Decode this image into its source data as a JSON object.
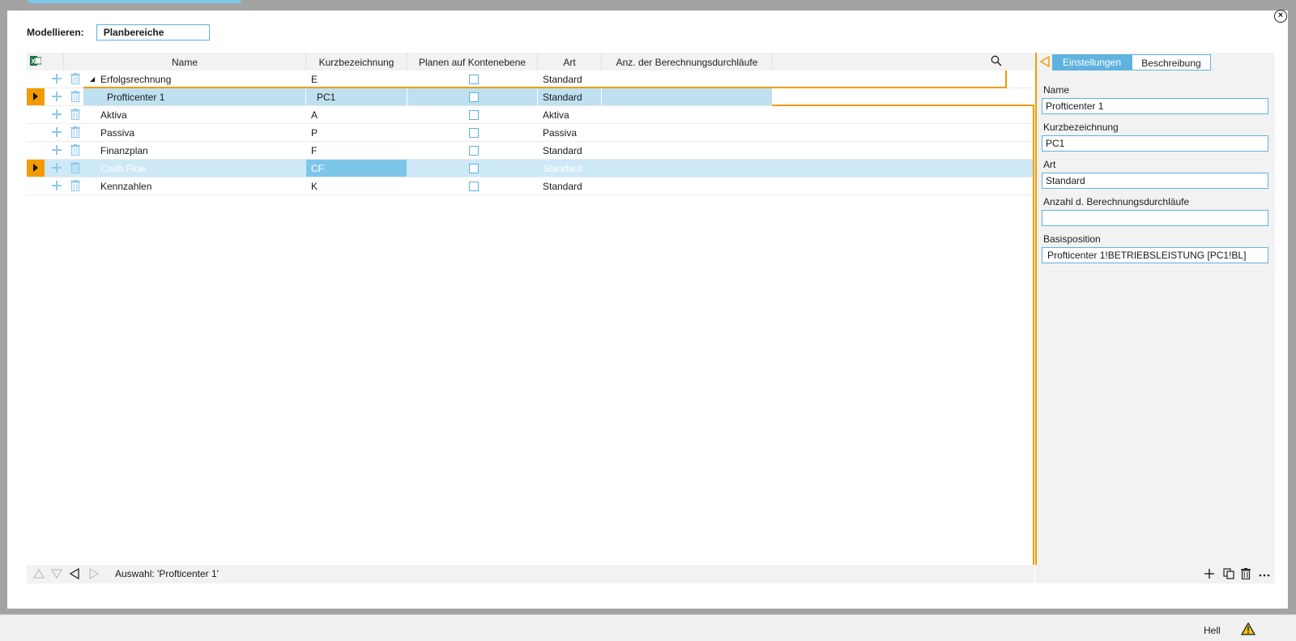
{
  "modeling": {
    "label": "Modellieren:",
    "value": "Planbereiche"
  },
  "grid": {
    "columns": [
      "Name",
      "Kurzbezeichnung",
      "Planen auf Kontenebene",
      "Art",
      "Anz. der Berechnungsdurchläufe"
    ],
    "rows": [
      {
        "name": "Erfolgsrechnung",
        "short": "E",
        "art": "Standard",
        "runs": "",
        "expanded": true,
        "state": "normal"
      },
      {
        "name": "Profticenter 1",
        "short": "PC1",
        "art": "Standard",
        "runs": "",
        "state": "selected"
      },
      {
        "name": "Aktiva",
        "short": "A",
        "art": "Aktiva",
        "runs": "",
        "state": "normal"
      },
      {
        "name": "Passiva",
        "short": "P",
        "art": "Passiva",
        "runs": "",
        "state": "normal"
      },
      {
        "name": "Finanzplan",
        "short": "F",
        "art": "Standard",
        "runs": "",
        "state": "normal"
      },
      {
        "name": "Cash Flow",
        "short": "CF",
        "art": "Standard",
        "runs": "",
        "state": "hover"
      },
      {
        "name": "Kennzahlen",
        "short": "K",
        "art": "Standard",
        "runs": "",
        "state": "normal"
      }
    ]
  },
  "status": {
    "selection": "Auswahl: 'Profticenter 1'"
  },
  "panel": {
    "tabs": [
      "Einstellungen",
      "Beschreibung"
    ],
    "fields": [
      {
        "label": "Name",
        "value": "Profticenter 1"
      },
      {
        "label": "Kurzbezeichnung",
        "value": "PC1"
      },
      {
        "label": "Art",
        "value": "Standard"
      },
      {
        "label": "Anzahl d. Berechnungsdurchläufe",
        "value": ""
      },
      {
        "label": "Basisposition",
        "value": "Profticenter 1!BETRIEBSLEISTUNG [PC1!BL]"
      }
    ]
  },
  "footer": {
    "theme": "Hell"
  },
  "colors": {
    "accent": "#5fb3de",
    "highlight": "#f29b00",
    "selected_row": "#bfe0f0",
    "hover_row": "#cde9f8",
    "hover_cell": "#7cc6ea"
  },
  "icons": {
    "excel": "excel-icon",
    "search": "search-icon",
    "close": "close-icon",
    "collapse_panel": "collapse-left-icon",
    "add": "plus-icon",
    "delete": "trash-icon",
    "copy": "copy-icon",
    "more": "more-icon",
    "warning": "warning-icon"
  }
}
